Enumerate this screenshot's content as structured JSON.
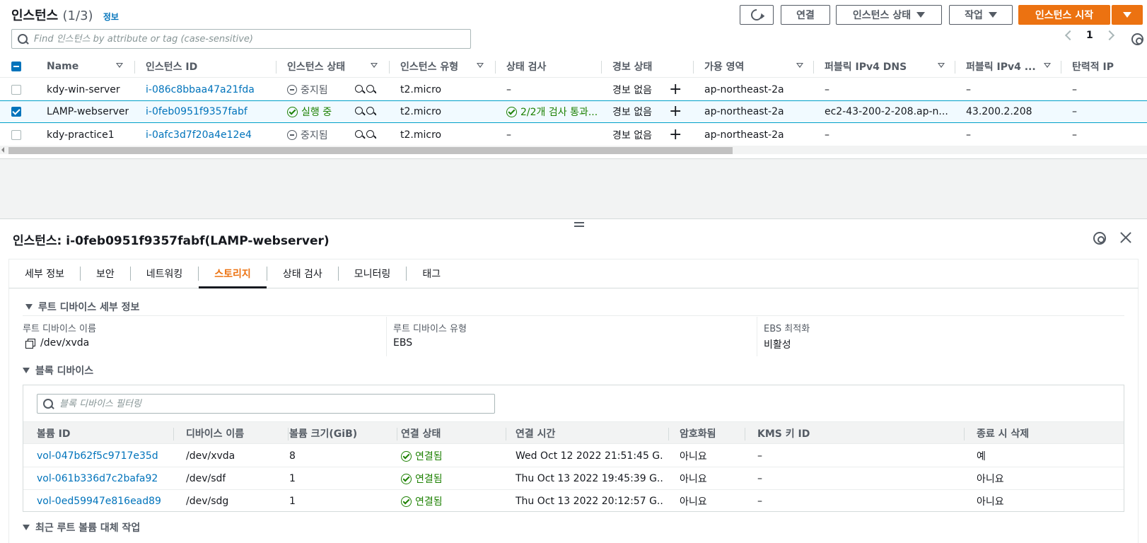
{
  "header": {
    "title": "인스턴스",
    "count": "(1/3)",
    "info": "정보",
    "buttons": {
      "connect": "연결",
      "instance_state": "인스턴스 상태",
      "actions": "작업",
      "launch": "인스턴스 시작"
    },
    "search_placeholder": "Find 인스턴스 by attribute or tag (case-sensitive)",
    "page": "1"
  },
  "table": {
    "columns": [
      "Name",
      "인스턴스 ID",
      "인스턴스 상태",
      "인스턴스 유형",
      "상태 검사",
      "경보 상태",
      "가용 영역",
      "퍼블릭 IPv4 DNS",
      "퍼블릭 IPv4 ...",
      "탄력적 IP"
    ],
    "rows": [
      {
        "name": "kdy-win-server",
        "id": "i-086c8bbaa47a21fda",
        "state": "중지됨",
        "type": "t2.micro",
        "check": "–",
        "alarm": "경보 없음",
        "az": "ap-northeast-2a",
        "dns": "–",
        "ip": "–",
        "eip": "–",
        "selected": false
      },
      {
        "name": "LAMP-webserver",
        "id": "i-0feb0951f9357fabf",
        "state": "실행 중",
        "type": "t2.micro",
        "check": "2/2개 검사 통과...",
        "alarm": "경보 없음",
        "az": "ap-northeast-2a",
        "dns": "ec2-43-200-2-208.ap-n...",
        "ip": "43.200.2.208",
        "eip": "–",
        "selected": true
      },
      {
        "name": "kdy-practice1",
        "id": "i-0afc3d7f20a4e12e4",
        "state": "중지됨",
        "type": "t2.micro",
        "check": "–",
        "alarm": "경보 없음",
        "az": "ap-northeast-2a",
        "dns": "–",
        "ip": "–",
        "eip": "–",
        "selected": false
      }
    ]
  },
  "detail": {
    "title": "인스턴스: i-0feb0951f9357fabf(LAMP-webserver)",
    "tabs": [
      "세부 정보",
      "보안",
      "네트워킹",
      "스토리지",
      "상태 검사",
      "모니터링",
      "태그"
    ],
    "active_tab": "스토리지",
    "root_section": "루트 디바이스 세부 정보",
    "root": {
      "name_label": "루트 디바이스 이름",
      "name_value": "/dev/xvda",
      "type_label": "루트 디바이스 유형",
      "type_value": "EBS",
      "ebs_label": "EBS 최적화",
      "ebs_value": "비활성"
    },
    "block_section": "블록 디바이스",
    "block_search_placeholder": "블록 디바이스 필터링",
    "block_columns": [
      "볼륨 ID",
      "디바이스 이름",
      "볼륨 크기(GiB)",
      "연결 상태",
      "연결 시간",
      "암호화됨",
      "KMS 키 ID",
      "종료 시 삭제"
    ],
    "block_rows": [
      {
        "volume": "vol-047b62f5c9717e35d",
        "device": "/dev/xvda",
        "size": "8",
        "status": "연결됨",
        "time": "Wed Oct 12 2022 21:51:45 G...",
        "encrypted": "아니요",
        "kms": "–",
        "delete": "예"
      },
      {
        "volume": "vol-061b336d7c2bafa92",
        "device": "/dev/sdf",
        "size": "1",
        "status": "연결됨",
        "time": "Thu Oct 13 2022 19:45:39 G...",
        "encrypted": "아니요",
        "kms": "–",
        "delete": "아니요"
      },
      {
        "volume": "vol-0ed59947e816ead89",
        "device": "/dev/sdg",
        "size": "1",
        "status": "연결됨",
        "time": "Thu Oct 13 2022 20:12:57 G...",
        "encrypted": "아니요",
        "kms": "–",
        "delete": "아니요"
      }
    ],
    "recent_section": "최근 루트 볼륨 대체 작업"
  },
  "colors": {
    "accent": "#ec7211",
    "link": "#0073bb",
    "success": "#1d8102"
  }
}
